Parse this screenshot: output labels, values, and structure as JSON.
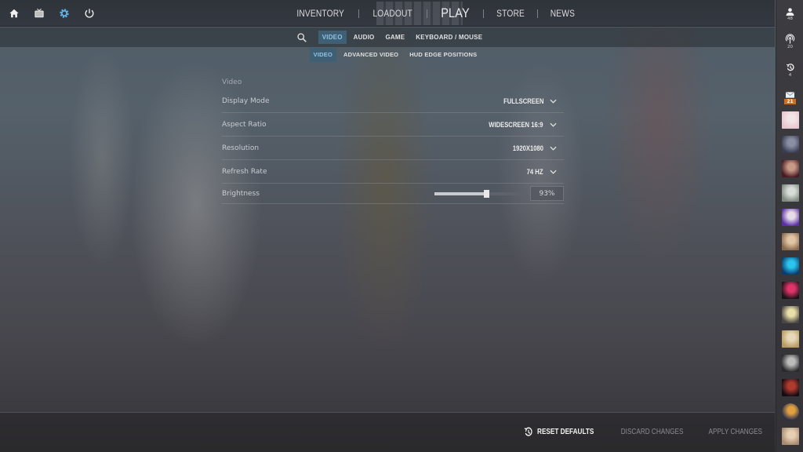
{
  "top_icons": [
    {
      "name": "home-icon",
      "label": "Home"
    },
    {
      "name": "tv-icon",
      "label": "Watch"
    },
    {
      "name": "gear-icon",
      "label": "Settings",
      "active": true
    },
    {
      "name": "power-icon",
      "label": "Quit"
    }
  ],
  "main_nav": {
    "items": [
      "INVENTORY",
      "LOADOUT",
      "PLAY",
      "STORE",
      "NEWS"
    ]
  },
  "settings_tabs": {
    "items": [
      "VIDEO",
      "AUDIO",
      "GAME",
      "KEYBOARD / MOUSE"
    ],
    "active": "VIDEO"
  },
  "video_subtabs": {
    "items": [
      "VIDEO",
      "ADVANCED VIDEO",
      "HUD EDGE POSITIONS"
    ],
    "active": "VIDEO"
  },
  "video_section": {
    "title": "Video",
    "rows": [
      {
        "label": "Display Mode",
        "value": "FULLSCREEN"
      },
      {
        "label": "Aspect Ratio",
        "value": "WIDESCREEN 16:9"
      },
      {
        "label": "Resolution",
        "value": "1920X1080"
      },
      {
        "label": "Refresh Rate",
        "value": "74 HZ"
      }
    ],
    "brightness": {
      "label": "Brightness",
      "value_text": "93%",
      "slider_fraction": 0.59
    }
  },
  "footer": {
    "reset": "RESET DEFAULTS",
    "discard": "DISCARD CHANGES",
    "apply": "APPLY CHANGES"
  },
  "right_sidebar": {
    "friends_online": "48",
    "broadcasts": "20",
    "recent": "4",
    "mail": "21",
    "friend_avatar_colors": [
      [
        "#e9c6cf",
        "#f2e4e6"
      ],
      [
        "#3a3d52",
        "#8b8fa4"
      ],
      [
        "#4a1a22",
        "#c79a88"
      ],
      [
        "#7f8a80",
        "#d8dcd8"
      ],
      [
        "#5b2fa8",
        "#e6dbe8"
      ],
      [
        "#8a6a4e",
        "#e2c6a4"
      ],
      [
        "#0a3d6e",
        "#2bc4ee"
      ],
      [
        "#1a1216",
        "#e0336a"
      ],
      [
        "#4a4646",
        "#e8e0a8"
      ],
      [
        "#b79a60",
        "#e6d8b8"
      ],
      [
        "#2a2a2a",
        "#bcbcbc"
      ],
      [
        "#140c12",
        "#b03a2e"
      ],
      [
        "#1a2650",
        "#e0a040"
      ],
      [
        "#a88a70",
        "#e6d0b4"
      ]
    ]
  },
  "colors": {
    "accent_blue": "#8fc3e4",
    "active_tab_bg": "#3f5f74",
    "mail_badge": "#d36d1a"
  }
}
